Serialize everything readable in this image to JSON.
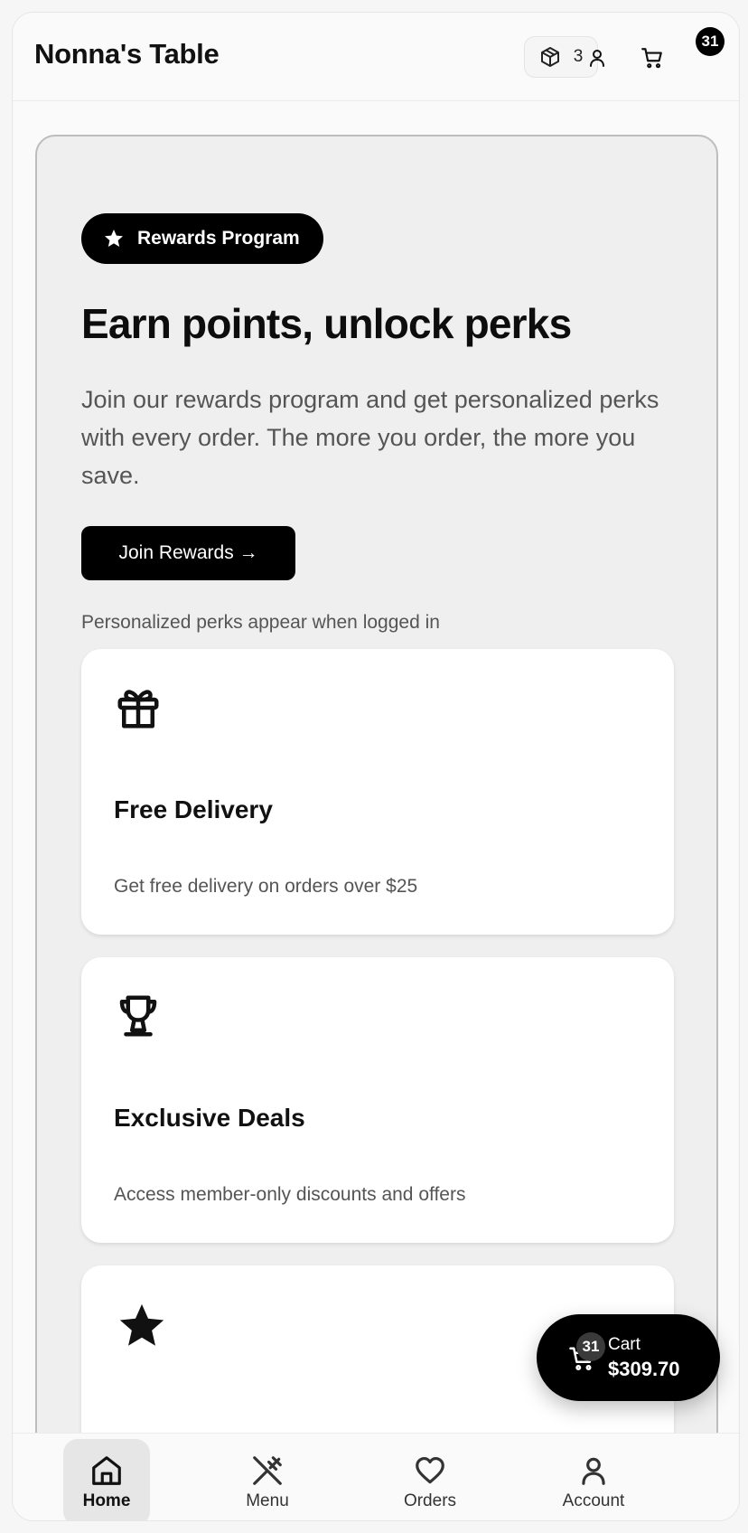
{
  "header": {
    "brand": "Nonna's Table",
    "orders_count": "3",
    "cart_count": "31",
    "icons": [
      "package-icon",
      "user-icon",
      "cart-icon"
    ]
  },
  "hero": {
    "badge_label": "Rewards Program",
    "title": "Earn points, unlock perks",
    "description": "Join our rewards program and get personalized perks with every order. The more you order, the more you save.",
    "cta_label": "Join Rewards →",
    "note": "Personalized perks appear when logged in"
  },
  "perks": [
    {
      "icon": "gift-icon",
      "title": "Free Delivery",
      "description": "Get free delivery on orders over $25"
    },
    {
      "icon": "trophy-icon",
      "title": "Exclusive Deals",
      "description": "Access member-only discounts and offers"
    },
    {
      "icon": "star-icon",
      "title": "",
      "description": ""
    }
  ],
  "floating_cart": {
    "count": "31",
    "label": "Cart",
    "total": "$309.70"
  },
  "bottom_nav": [
    {
      "label": "Home",
      "icon": "home-icon",
      "active": true
    },
    {
      "label": "Menu",
      "icon": "utensils-icon",
      "active": false
    },
    {
      "label": "Orders",
      "icon": "heart-icon",
      "active": false
    },
    {
      "label": "Account",
      "icon": "account-icon",
      "active": false
    }
  ],
  "colors": {
    "accent": "#000000",
    "background": "#fafafa",
    "hero_bg": "#efefef",
    "muted_text": "#555555"
  }
}
